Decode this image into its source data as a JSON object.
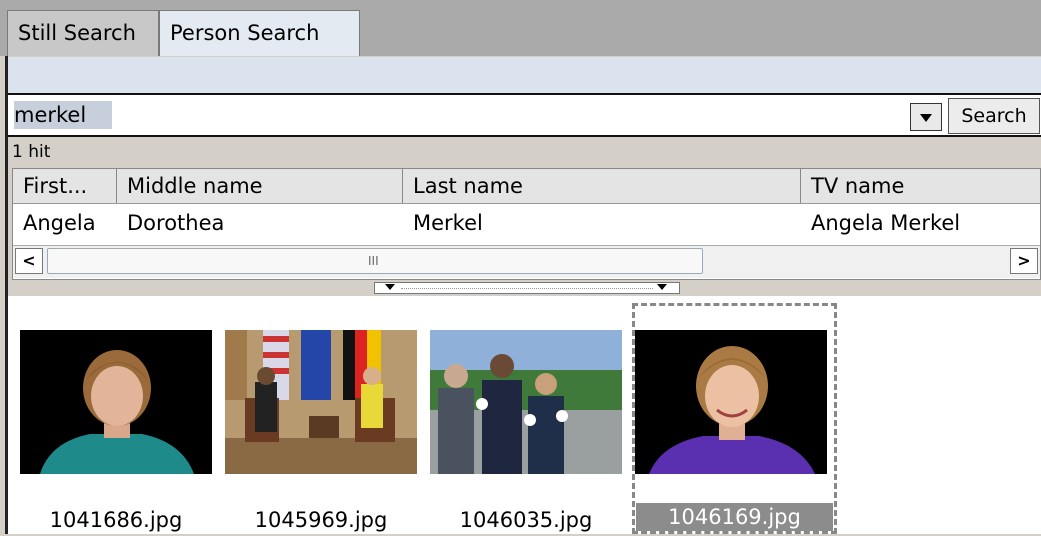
{
  "tabs": [
    {
      "label": "Still Search",
      "active": false
    },
    {
      "label": "Person Search",
      "active": true
    }
  ],
  "search": {
    "value": "merkel",
    "button_label": "Search"
  },
  "results": {
    "hit_count": "1 hit",
    "columns": [
      "First...",
      "Middle name",
      "Last name",
      "TV name"
    ],
    "rows": [
      [
        "Angela",
        "Dorothea",
        "Merkel",
        "Angela Merkel"
      ]
    ]
  },
  "scrollbar": {
    "left_arrow": "<",
    "right_arrow": ">",
    "grip": "III"
  },
  "gallery": {
    "images": [
      {
        "filename": "1041686.jpg",
        "selected": false
      },
      {
        "filename": "1045969.jpg",
        "selected": false
      },
      {
        "filename": "1046035.jpg",
        "selected": false
      },
      {
        "filename": "1046169.jpg",
        "selected": true
      }
    ]
  },
  "colors": {
    "tab_active": "#e4eaf2",
    "band": "#dbe3ee",
    "selection": "#8c8c8c"
  }
}
